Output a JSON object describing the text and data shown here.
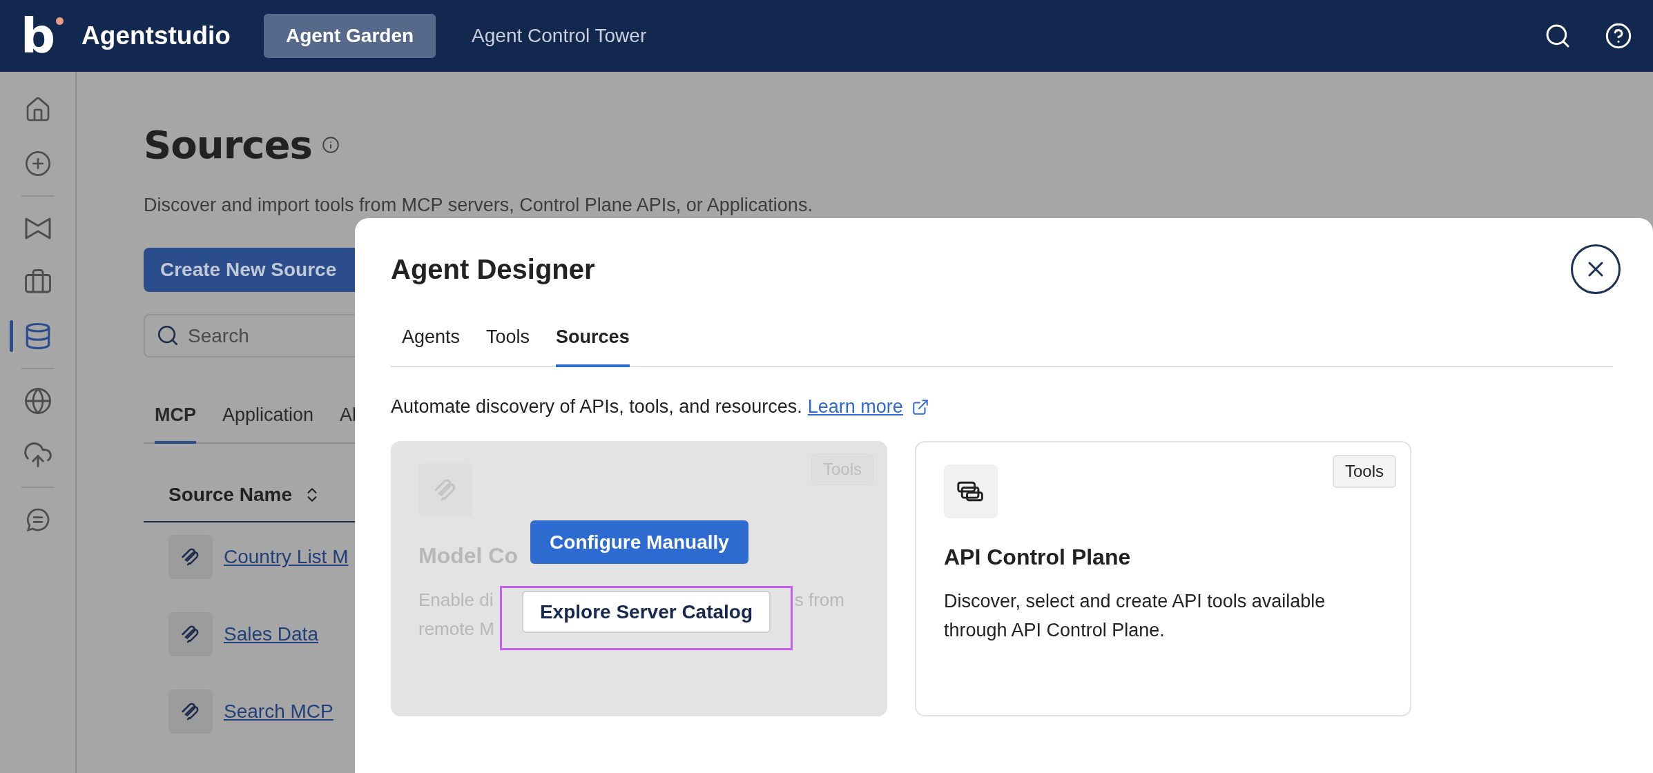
{
  "top_bar": {
    "brand_mark": "b",
    "brand": "Agentstudio",
    "nav": [
      {
        "label": "Agent Garden",
        "selected": true
      },
      {
        "label": "Agent Control Tower",
        "selected": false
      }
    ]
  },
  "sidebar": {
    "items": [
      {
        "kind": "home",
        "selected": false
      },
      {
        "kind": "add",
        "selected": false
      },
      {
        "kind": "divider"
      },
      {
        "kind": "bowtie",
        "selected": false
      },
      {
        "kind": "briefcase",
        "selected": false
      },
      {
        "kind": "database",
        "selected": true
      },
      {
        "kind": "divider"
      },
      {
        "kind": "globe",
        "selected": false
      },
      {
        "kind": "upload",
        "selected": false
      },
      {
        "kind": "divider"
      },
      {
        "kind": "chat",
        "selected": false
      }
    ]
  },
  "page": {
    "title": "Sources",
    "description": "Discover and import tools from MCP servers, Control Plane APIs, or Applications.",
    "create_button": "Create New Source",
    "search": {
      "placeholder": "Search"
    },
    "tabs": [
      {
        "label": "MCP",
        "selected": true
      },
      {
        "label": "Application",
        "selected": false
      },
      {
        "label": "Al",
        "selected": false
      }
    ],
    "table": {
      "columns": [
        "Source Name"
      ],
      "rows": [
        {
          "name": "Country List M"
        },
        {
          "name": "Sales Data"
        },
        {
          "name": "Search MCP"
        }
      ]
    }
  },
  "modal": {
    "title": "Agent Designer",
    "tabs": [
      {
        "label": "Agents",
        "selected": false
      },
      {
        "label": "Tools",
        "selected": false
      },
      {
        "label": "Sources",
        "selected": true
      }
    ],
    "description": "Automate discovery of APIs, tools, and resources.",
    "link": "Learn more",
    "cards": [
      {
        "kind": "mcp",
        "dimmed": true,
        "badge": "Tools",
        "title": "Model Co",
        "description_lines": [
          {
            "left": "Enable di",
            "right": "s from"
          },
          {
            "left": "remote M"
          }
        ],
        "actions": [
          {
            "label": "Configure Manually",
            "kind": "primary",
            "highlighted": false
          },
          {
            "label": "Explore Server Catalog",
            "kind": "secondary",
            "highlighted": true
          }
        ]
      },
      {
        "kind": "api",
        "dimmed": false,
        "badge": "Tools",
        "title": "API Control Plane",
        "description": "Discover, select and create API tools available through API Control Plane."
      }
    ]
  }
}
